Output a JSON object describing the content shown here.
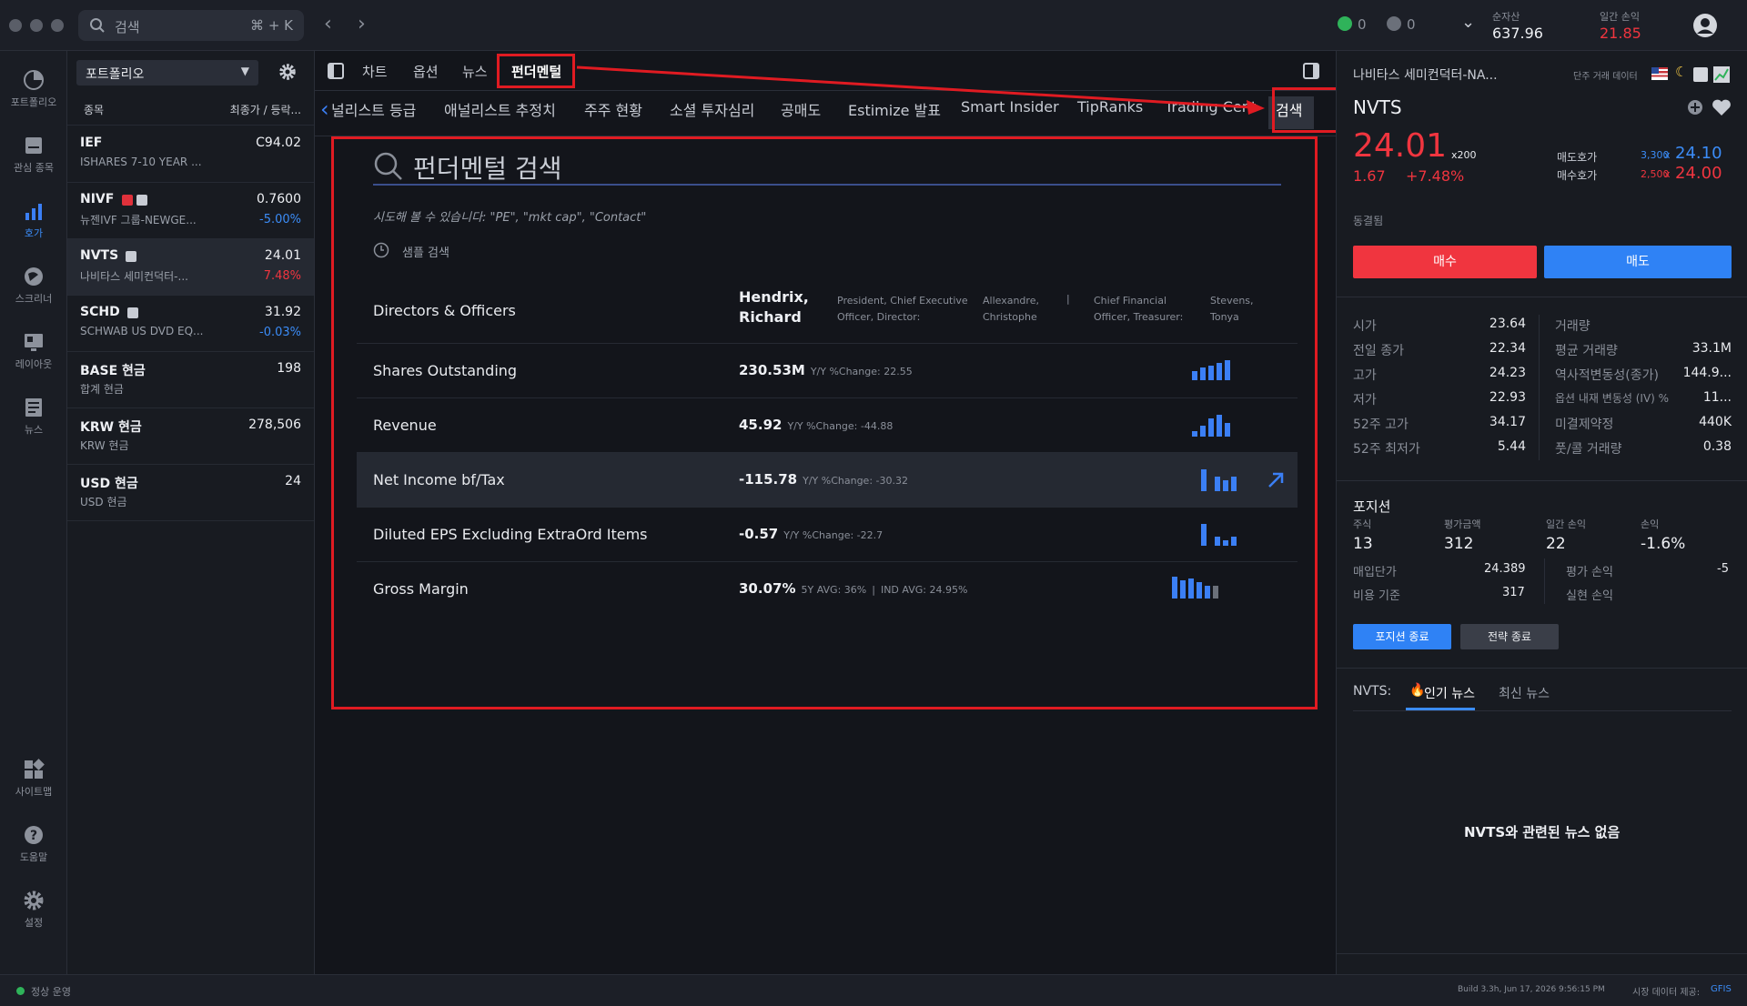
{
  "topbar": {
    "search_placeholder": "검색",
    "search_shortcut": "⌘ + K",
    "status_green_count": "0",
    "status_gray_count": "0",
    "net_assets_label": "순자산",
    "net_assets_value": "637.96",
    "daily_pl_label": "일간 손익",
    "daily_pl_value": "21.85"
  },
  "rail": {
    "items": [
      {
        "label": "포트폴리오",
        "icon": "portfolio-icon"
      },
      {
        "label": "관심 종목",
        "icon": "watchlist-icon"
      },
      {
        "label": "호가",
        "icon": "quote-icon"
      },
      {
        "label": "스크리너",
        "icon": "screener-icon"
      },
      {
        "label": "레이아웃",
        "icon": "layout-icon"
      },
      {
        "label": "뉴스",
        "icon": "news-icon"
      },
      {
        "label": "사이트맵",
        "icon": "sitemap-icon"
      },
      {
        "label": "도움말",
        "icon": "help-icon"
      },
      {
        "label": "설정",
        "icon": "settings-icon"
      }
    ]
  },
  "portfolio": {
    "selector": "포트폴리오",
    "col_symbol": "종목",
    "col_price": "최종가 / 등락...",
    "rows": [
      {
        "ticker": "IEF",
        "name": "ISHARES 7-10 YEAR ...",
        "price": "C94.02",
        "change": ""
      },
      {
        "ticker": "NIVF",
        "name": "뉴젠IVF 그룹-NEWGE...",
        "price": "0.7600",
        "change": "-5.00%"
      },
      {
        "ticker": "NVTS",
        "name": "나비타스 세미컨덕터-...",
        "price": "24.01",
        "change": "7.48%"
      },
      {
        "ticker": "SCHD",
        "name": "SCHWAB US DVD EQ...",
        "price": "31.92",
        "change": "-0.03%"
      },
      {
        "ticker": "BASE 현금",
        "name": "합계 현금",
        "price": "198",
        "change": ""
      },
      {
        "ticker": "KRW 현금",
        "name": "KRW 현금",
        "price": "278,506",
        "change": ""
      },
      {
        "ticker": "USD 현금",
        "name": "USD 현금",
        "price": "24",
        "change": ""
      }
    ]
  },
  "center": {
    "tabs": [
      "차트",
      "옵션",
      "뉴스",
      "펀더멘털"
    ],
    "subtabs": [
      "널리스트 등급",
      "애널리스트 추정치",
      "주주 현황",
      "소셜 투자심리",
      "공매도",
      "Estimize 발표",
      "Smart Insider",
      "TipRanks",
      "Trading Central",
      "검색"
    ],
    "search_title": "펀더멘털 검색",
    "hint": "시도해 볼 수 있습니다: \"PE\", \"mkt cap\", \"Contact\"",
    "sample_search": "샘플 검색",
    "rows": [
      {
        "label": "Directors & Officers",
        "value": "Hendrix,\nRichard",
        "sub": ""
      },
      {
        "label": "Shares Outstanding",
        "value": "230.53M",
        "sub": "Y/Y %Change: 22.55"
      },
      {
        "label": "Revenue",
        "value": "45.92",
        "sub": "Y/Y %Change: -44.88"
      },
      {
        "label": "Net Income bf/Tax",
        "value": "-115.78",
        "sub": "Y/Y %Change: -30.32"
      },
      {
        "label": "Diluted EPS Excluding ExtraOrd Items",
        "value": "-0.57",
        "sub": "Y/Y %Change: -22.7"
      },
      {
        "label": "Gross Margin",
        "value": "30.07%",
        "sub": "5Y AVG: 36%",
        "sub2": "IND AVG: 24.95%"
      }
    ],
    "officers": {
      "role1": "President, Chief Executive Officer, Director:",
      "name2": "Allexandre, Christophe",
      "role2": "Chief Financial Officer, Treasurer:",
      "name3": "Stevens, Tonya"
    }
  },
  "right": {
    "company": "나비타스 세미컨덕터-NA...",
    "delayed": "단주 거래 데이터",
    "ticker": "NVTS",
    "last": "24.01",
    "multiplier": "x200",
    "change": "1.67",
    "change_pct": "+7.48%",
    "ask_label": "매도호가",
    "ask_size": "3,300",
    "ask_price": "24.10",
    "bid_label": "매수호가",
    "bid_size": "2,500",
    "bid_price": "24.00",
    "frozen": "동결됨",
    "buy": "매수",
    "sell": "매도",
    "stats_left": [
      {
        "k": "시가",
        "v": "23.64"
      },
      {
        "k": "전일 종가",
        "v": "22.34"
      },
      {
        "k": "고가",
        "v": "24.23"
      },
      {
        "k": "저가",
        "v": "22.93"
      },
      {
        "k": "52주 고가",
        "v": "34.17"
      },
      {
        "k": "52주 최저가",
        "v": "5.44"
      }
    ],
    "stats_right": [
      {
        "k": "거래량",
        "v": ""
      },
      {
        "k": "평균 거래량",
        "v": "33.1M"
      },
      {
        "k": "역사적변동성(종가)",
        "v": "144.9..."
      },
      {
        "k": "옵션 내재 변동성 (IV) %",
        "v": "11..."
      },
      {
        "k": "미결제약정",
        "v": "440K"
      },
      {
        "k": "풋/콜 거래량",
        "v": "0.38"
      }
    ],
    "position": {
      "title": "포지션",
      "h_shares": "주식",
      "h_value": "평가금액",
      "h_daily": "일간 손익",
      "h_pl": "손익",
      "shares": "13",
      "value": "312",
      "daily": "22",
      "pl": "-1.6%",
      "avg_label": "매입단가",
      "avg": "24.389",
      "cost_label": "비용 기준",
      "cost": "317",
      "unreal_label": "평가 손익",
      "unreal": "-5",
      "real_label": "실현 손익",
      "real": "",
      "close_btn": "포지션 종료",
      "strategy_btn": "전략 종료"
    },
    "news": {
      "prefix": "NVTS:",
      "tab_hot": "인기 뉴스",
      "tab_latest": "최신 뉴스",
      "empty": "NVTS와 관련된 뉴스 없음"
    }
  },
  "statusbar": {
    "status": "정상 운영",
    "build": "Build 3.3h, Jun 17, 2026 9:56:15 PM",
    "market_data": "시장 데이터 제공:",
    "provider": "GFIS"
  }
}
